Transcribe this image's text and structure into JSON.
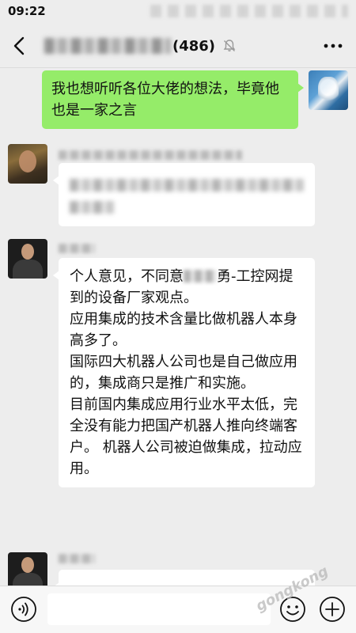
{
  "status_bar": {
    "time": "09:22"
  },
  "header": {
    "title_count": "(486)"
  },
  "messages": {
    "mine": {
      "text": "我也想听听各位大佬的想法，毕竟他也是一家之言"
    },
    "reply": {
      "line1_before": "个人意见，不同意",
      "line1_after": "勇-工控网提到的设备厂家观点。",
      "line2": "应用集成的技术含量比做机器人本身高多了。",
      "line3": "国际四大机器人公司也是自己做应用的，集成商只是推广和实施。",
      "line4": "目前国内集成应用行业水平太低，完全没有能力把国产机器人推向终端客户。 机器人公司被迫做集成，拉动应用。"
    }
  },
  "input_bar": {
    "value": "",
    "placeholder": ""
  },
  "watermark": {
    "text": "gongkong"
  }
}
